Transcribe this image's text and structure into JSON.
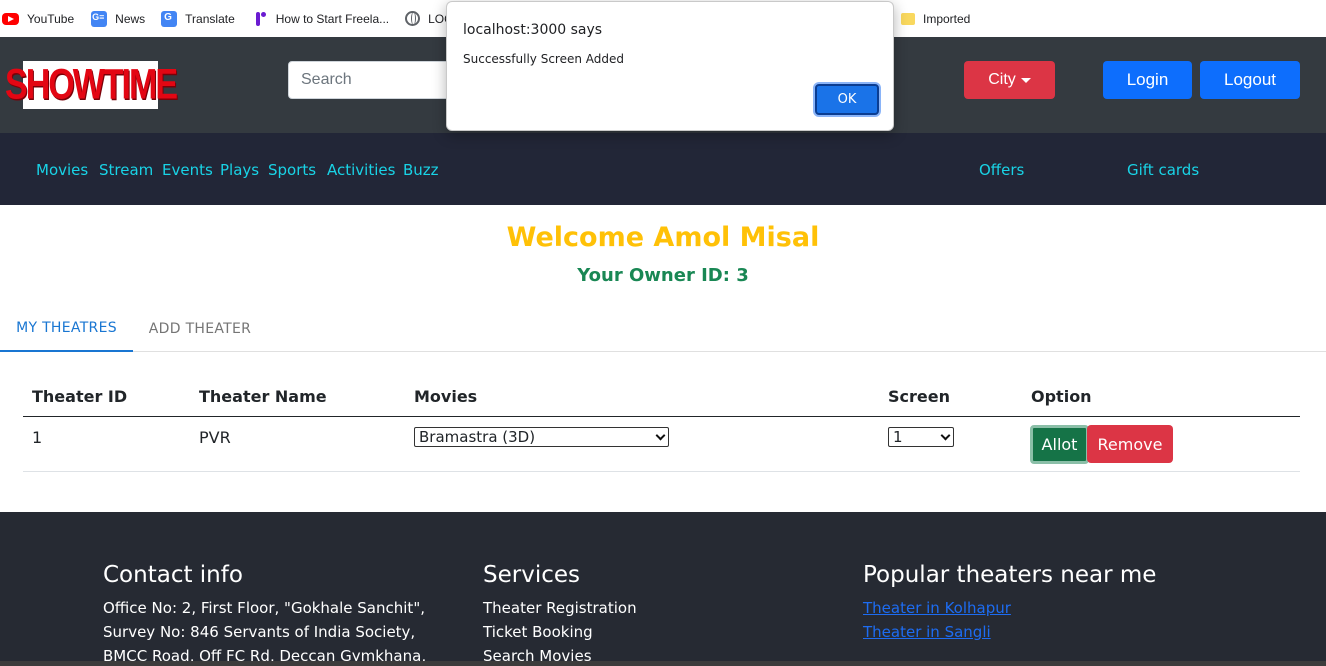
{
  "bookmarks": [
    {
      "label": "YouTube",
      "icon": "youtube-icon"
    },
    {
      "label": "News",
      "icon": "google-news-icon"
    },
    {
      "label": "Translate",
      "icon": "google-translate-icon"
    },
    {
      "label": "How to Start Freela...",
      "icon": "freelancer-icon"
    },
    {
      "label": "LOGI",
      "icon": "globe-icon"
    },
    {
      "label": "Imported",
      "icon": "folder-icon"
    }
  ],
  "header": {
    "logo_text": "SHOWTIME",
    "search_placeholder": "Search",
    "city_label": "City",
    "login_label": "Login",
    "logout_label": "Logout"
  },
  "nav": {
    "items": [
      "Movies",
      "Stream",
      "Events",
      "Plays",
      "Sports",
      "Activities",
      "Buzz"
    ],
    "offers": "Offers",
    "gift_cards": "Gift cards"
  },
  "welcome": {
    "title": "Welcome Amol Misal",
    "owner_id": "Your Owner ID: 3"
  },
  "tabs": [
    {
      "label": "MY THEATRES",
      "active": true
    },
    {
      "label": "ADD THEATER",
      "active": false
    }
  ],
  "table": {
    "headers": [
      "Theater ID",
      "Theater Name",
      "Movies",
      "Screen",
      "Option"
    ],
    "rows": [
      {
        "id": "1",
        "name": "PVR",
        "movie": "Bramastra (3D)",
        "screen": "1",
        "allot": "Allot",
        "remove": "Remove"
      }
    ]
  },
  "footer": {
    "contact": {
      "title": "Contact info",
      "lines": [
        "Office No: 2, First Floor, \"Gokhale Sanchit\",",
        "Survey No: 846 Servants of India Society,",
        "BMCC Road, Off FC Rd, Deccan Gymkhana,"
      ]
    },
    "services": {
      "title": "Services",
      "lines": [
        "Theater Registration",
        "Ticket Booking",
        "Search Movies"
      ]
    },
    "popular": {
      "title": "Popular theaters near me",
      "links": [
        "Theater in Kolhapur",
        "Theater in Sangli"
      ]
    }
  },
  "dialog": {
    "title": "localhost:3000 says",
    "message": "Successfully Screen Added",
    "ok_label": "OK"
  },
  "colors": {
    "navbar": "#343a40",
    "subnav": "#222637",
    "nav_link": "#19d3e6",
    "welcome": "#ffc107",
    "owner": "#198754",
    "primary": "#0d6efd",
    "danger": "#dc3545",
    "success": "#157347",
    "footer": "#262a33"
  }
}
